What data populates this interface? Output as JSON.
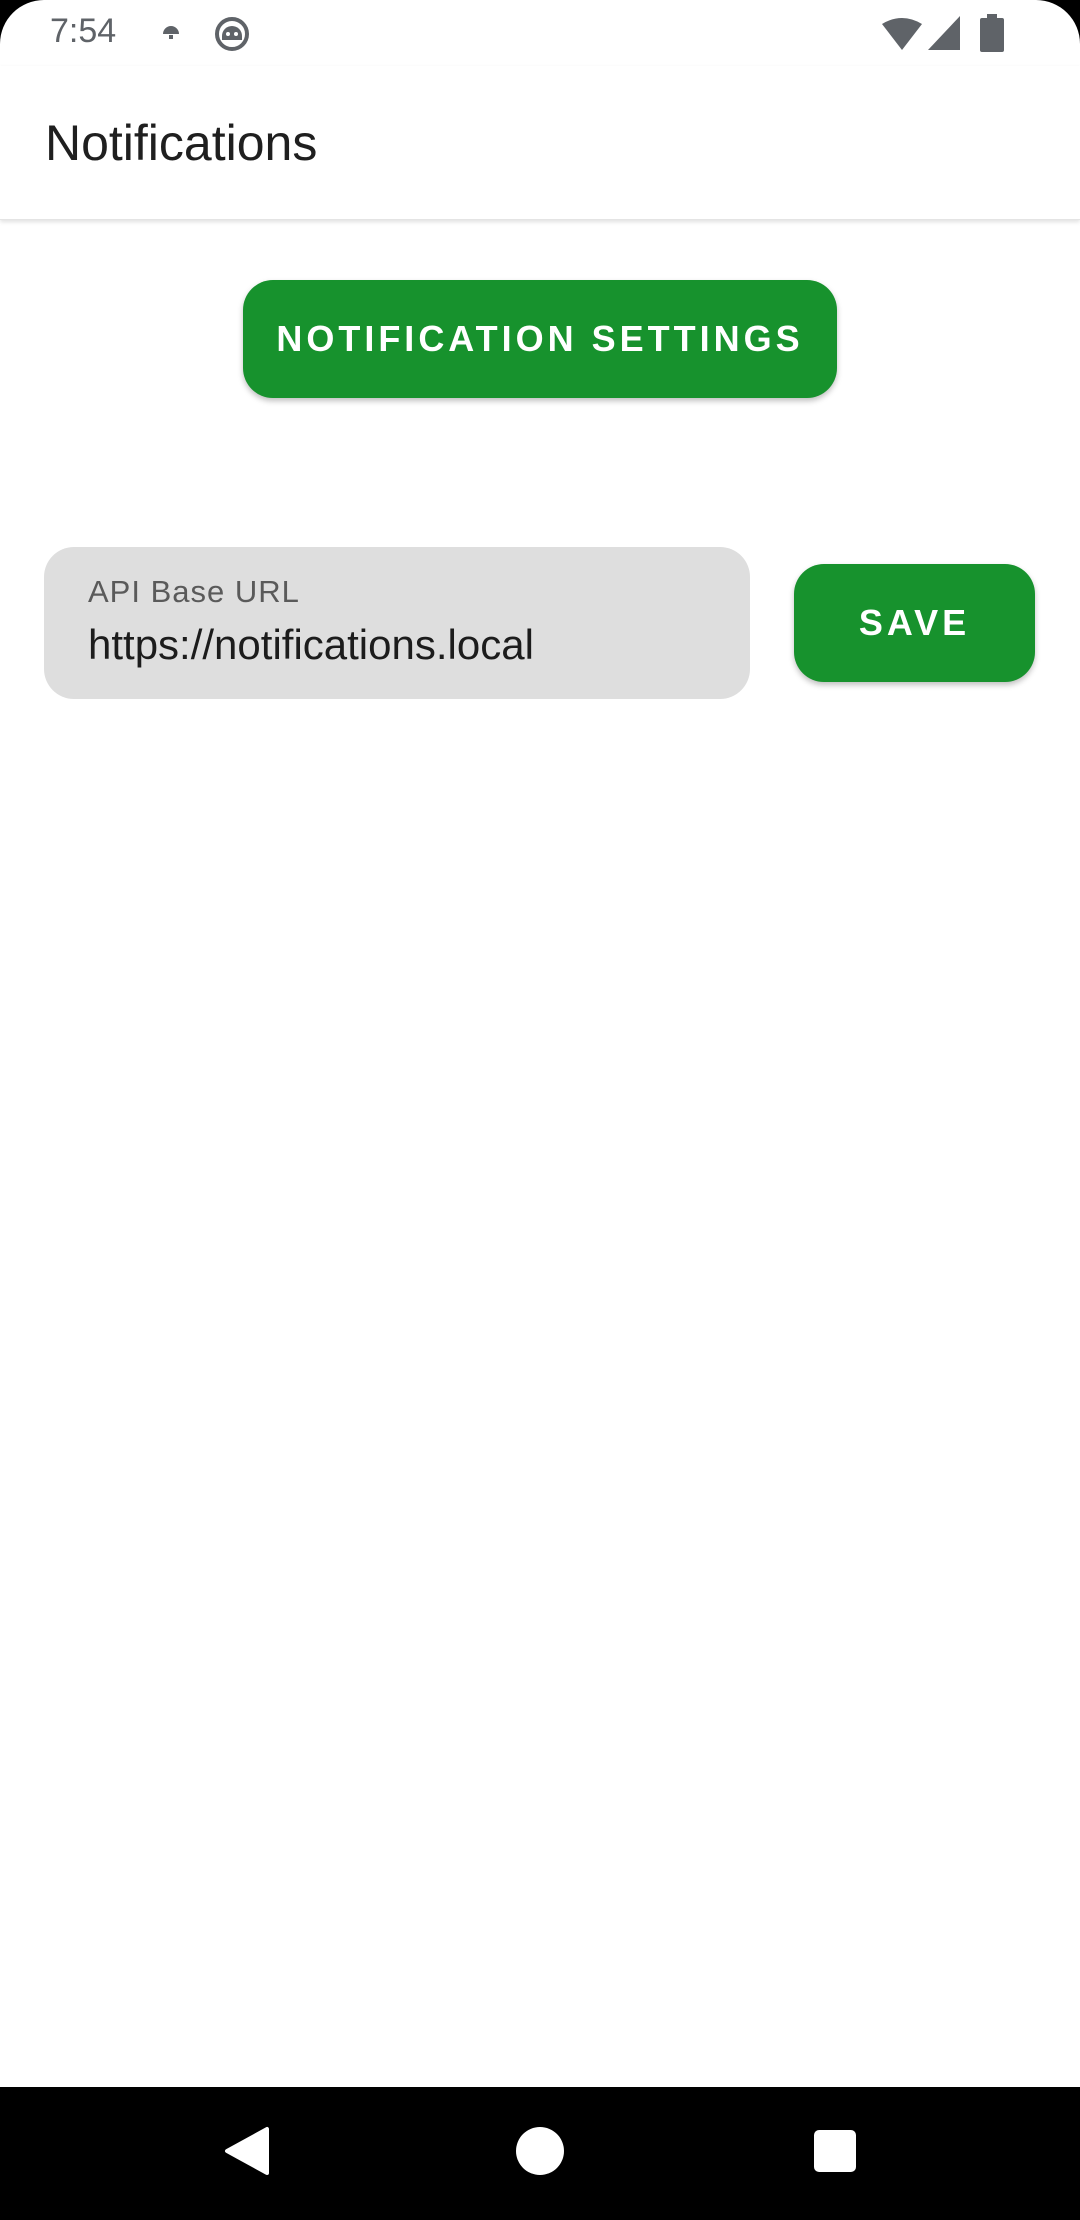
{
  "status_bar": {
    "time": "7:54",
    "icons": [
      "weather-icon",
      "android-face-icon",
      "wifi-icon",
      "cell-signal-icon",
      "battery-icon"
    ]
  },
  "app_bar": {
    "title": "Notifications"
  },
  "main": {
    "settings_button_label": "NOTIFICATION SETTINGS",
    "api_field": {
      "label": "API Base URL",
      "value": "https://notifications.local"
    },
    "save_button_label": "SAVE"
  },
  "nav_bar": {
    "buttons": [
      "back-icon",
      "home-icon",
      "recents-icon"
    ]
  },
  "colors": {
    "accent": "#17922d",
    "field_background": "#dedede",
    "nav_background": "#000000"
  }
}
